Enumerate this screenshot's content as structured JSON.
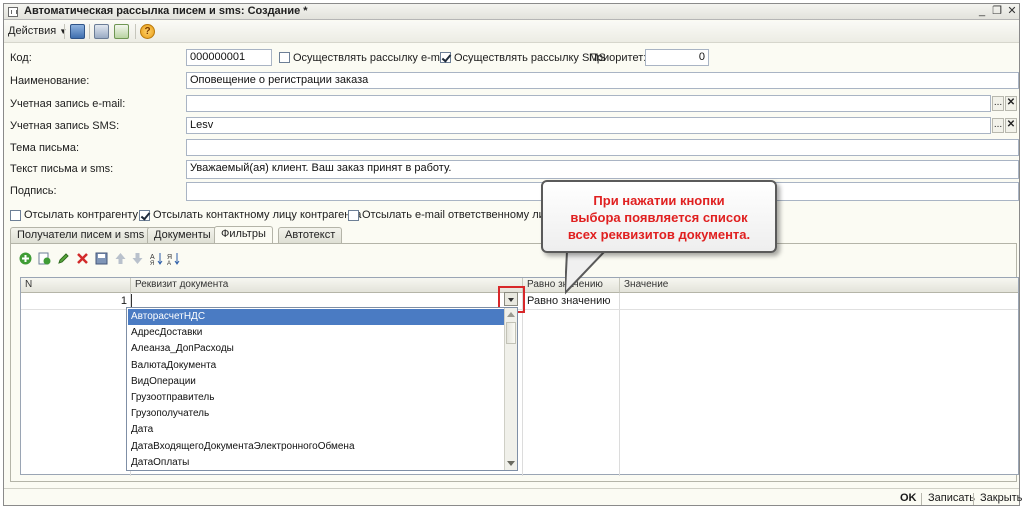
{
  "window": {
    "title": "Автоматическая рассылка писем и sms: Создание *",
    "min_glyph": "_",
    "restore_glyph": "❐",
    "close_glyph": "✕"
  },
  "toolbar": {
    "actions_label": "Действия",
    "help_glyph": "?"
  },
  "form": {
    "code_label": "Код:",
    "code_value": "000000001",
    "email_checkbox_label": "Осуществлять рассылку e-mail",
    "email_checked": false,
    "sms_checkbox_label": "Осуществлять рассылку SMS",
    "sms_checked": true,
    "priority_label": "Приоритет:",
    "priority_value": "0",
    "name_label": "Наименование:",
    "name_value": "Оповещение о регистрации заказа",
    "email_account_label": "Учетная запись e-mail:",
    "email_account_value": "",
    "sms_account_label": "Учетная запись SMS:",
    "sms_account_value": "Lesv",
    "subject_label": "Тема письма:",
    "subject_value": "",
    "body_label": "Текст письма и sms:",
    "body_value": "Уважаемый(ая) клиент. Ваш заказ принят в работу.",
    "signature_label": "Подпись:",
    "signature_value": "",
    "select_glyph": "...",
    "clear_glyph": "✕",
    "send_counterparty_label": "Отсылать контрагенту",
    "send_counterparty_checked": false,
    "send_contact_label": "Отсылать контактному лицу контрагента",
    "send_contact_checked": true,
    "send_responsible_label": "Отсылать e-mail ответственному лицу уве",
    "send_responsible_checked": false
  },
  "tabs": [
    {
      "label": "Получатели писем и sms",
      "active": false
    },
    {
      "label": "Документы",
      "active": false
    },
    {
      "label": "Фильтры",
      "active": true
    },
    {
      "label": "Автотекст",
      "active": false
    }
  ],
  "grid": {
    "columns": [
      "N",
      "Реквизит документа",
      "Равно значению",
      "Значение"
    ],
    "rows": [
      {
        "n": "1",
        "attribute": "",
        "condition": "Равно значению",
        "value": ""
      }
    ]
  },
  "dropdown": {
    "items": [
      "АвторасчетНДС",
      "АдресДоставки",
      "Алеанза_ДопРасходы",
      "ВалютаДокумента",
      "ВидОперации",
      "Грузоотправитель",
      "Грузополучатель",
      "Дата",
      "ДатаВходящегоДокументаЭлектронногоОбмена",
      "ДатаОплаты"
    ],
    "selected_index": 0
  },
  "callout": {
    "lines": [
      "При нажатии кнопки",
      "выбора появляется список",
      "всех реквизитов документа."
    ],
    "color": "#e02020"
  },
  "footer": {
    "ok_label": "OK",
    "save_label": "Записать",
    "close_label": "Закрыть"
  }
}
